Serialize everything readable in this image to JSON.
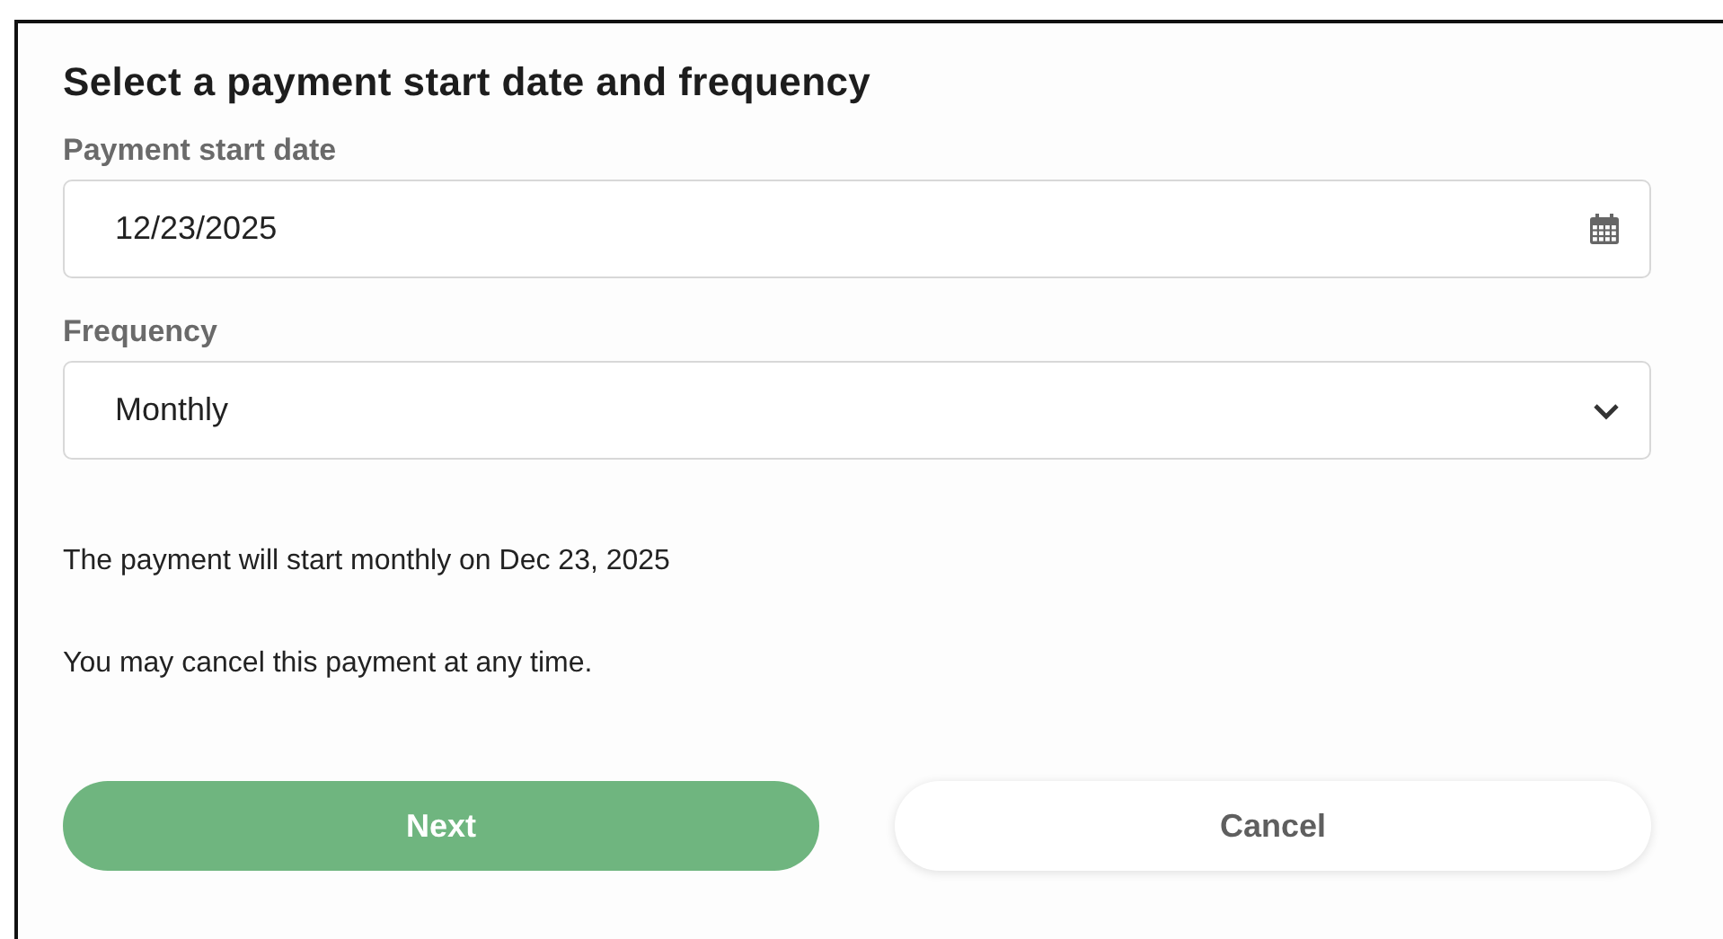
{
  "title": "Select a payment start date and frequency",
  "fields": [
    {
      "kind": "date",
      "label": "Payment start date",
      "value": "12/23/2025"
    },
    {
      "kind": "select",
      "label": "Frequency",
      "value": "Monthly"
    }
  ],
  "messages": [
    "The payment will start monthly on Dec 23, 2025",
    "You may cancel this payment at any time."
  ],
  "buttons": [
    {
      "kind": "primary",
      "label": "Next"
    },
    {
      "kind": "secondary",
      "label": "Cancel"
    }
  ]
}
